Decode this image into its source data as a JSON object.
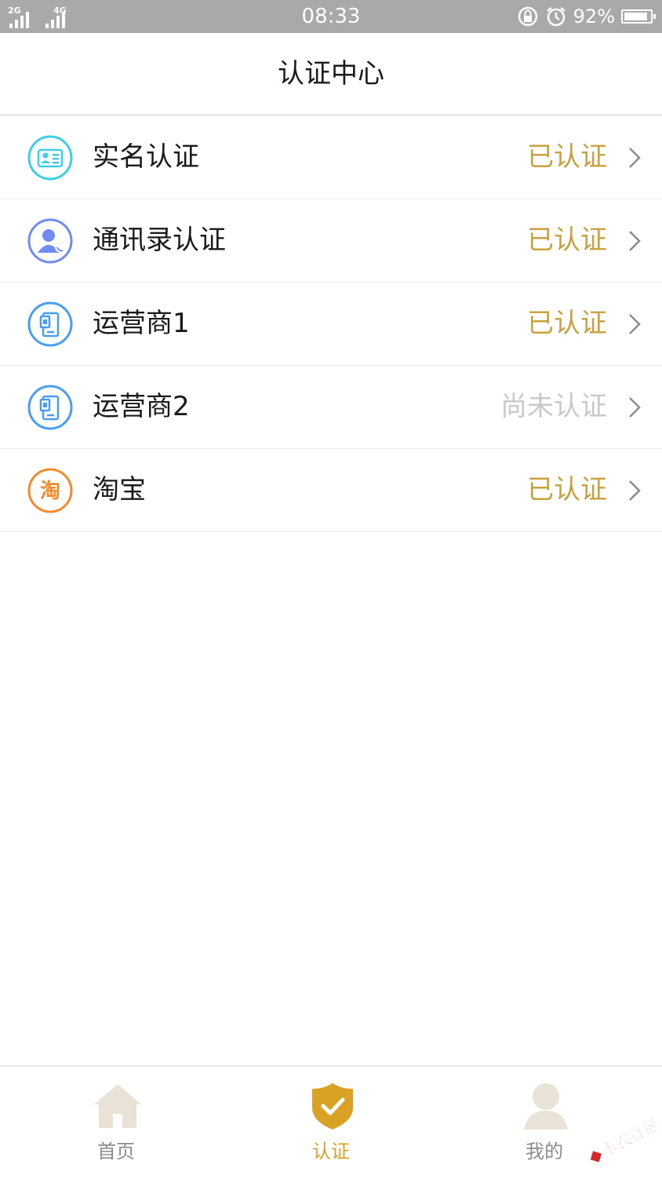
{
  "status_bar": {
    "network1": "2G",
    "network2": "4G",
    "time": "08:33",
    "battery_percent": "92%",
    "battery_level": 0.92
  },
  "header": {
    "title": "认证中心"
  },
  "colors": {
    "verified": "#c9a23f",
    "unverified": "#c9c9c9",
    "tab_active": "#d9a225",
    "tab_inactive": "#8c8c8c"
  },
  "items": [
    {
      "label": "实名认证",
      "status": "已认证",
      "verified": true,
      "icon": "id-card-icon"
    },
    {
      "label": "通讯录认证",
      "status": "已认证",
      "verified": true,
      "icon": "contacts-icon"
    },
    {
      "label": "运营商1",
      "status": "已认证",
      "verified": true,
      "icon": "phone-icon"
    },
    {
      "label": "运营商2",
      "status": "尚未认证",
      "verified": false,
      "icon": "phone-icon"
    },
    {
      "label": "淘宝",
      "status": "已认证",
      "verified": true,
      "icon": "taobao-icon",
      "icon_text": "淘"
    }
  ],
  "tabs": [
    {
      "label": "首页",
      "icon": "home-icon",
      "active": false
    },
    {
      "label": "认证",
      "icon": "shield-check-icon",
      "active": true
    },
    {
      "label": "我的",
      "icon": "user-icon",
      "active": false
    }
  ],
  "watermark": {
    "text": "卡农社区"
  }
}
